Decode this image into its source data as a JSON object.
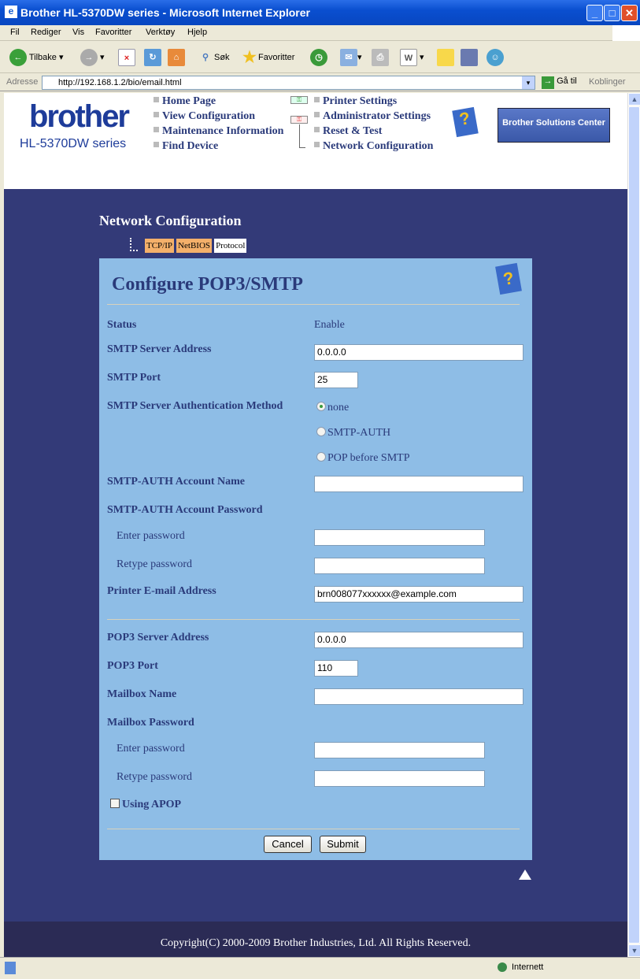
{
  "window": {
    "title": "Brother HL-5370DW series - Microsoft Internet Explorer"
  },
  "menu": [
    "Fil",
    "Rediger",
    "Vis",
    "Favoritter",
    "Verktøy",
    "Hjelp"
  ],
  "toolbar": {
    "back": "Tilbake",
    "search": "Søk",
    "favorites": "Favoritter"
  },
  "address": {
    "label": "Adresse",
    "url": "http://192.168.1.2/bio/email.html",
    "go": "Gå til",
    "links": "Koblinger"
  },
  "header": {
    "logo": "brother",
    "model": "HL-5370DW series",
    "solutions": "Brother Solutions Center",
    "nav_left": [
      "Home Page",
      "View Configuration",
      "Maintenance Information",
      "Find Device"
    ],
    "nav_right": [
      "Printer Settings",
      "Administrator Settings",
      "Reset & Test",
      "Network Configuration"
    ]
  },
  "section": {
    "title": "Network Configuration",
    "tabs": [
      "TCP/IP",
      "NetBIOS",
      "Protocol"
    ]
  },
  "form": {
    "title": "Configure POP3/SMTP",
    "status_label": "Status",
    "status_value": "Enable",
    "smtp_server_label": "SMTP Server Address",
    "smtp_server_value": "0.0.0.0",
    "smtp_port_label": "SMTP Port",
    "smtp_port_value": "25",
    "auth_label": "SMTP Server Authentication Method",
    "auth_options": [
      "none",
      "SMTP-AUTH",
      "POP before SMTP"
    ],
    "auth_selected": "none",
    "auth_account_label": "SMTP-AUTH Account Name",
    "auth_account_value": "",
    "auth_password_label": "SMTP-AUTH Account Password",
    "enter_password": "Enter password",
    "retype_password": "Retype password",
    "email_label": "Printer E-mail Address",
    "email_value": "brn008077xxxxxx@example.com",
    "pop3_server_label": "POP3 Server Address",
    "pop3_server_value": "0.0.0.0",
    "pop3_port_label": "POP3 Port",
    "pop3_port_value": "110",
    "mailbox_name_label": "Mailbox Name",
    "mailbox_name_value": "",
    "mailbox_password_label": "Mailbox Password",
    "apop_label": "Using APOP",
    "apop_checked": false,
    "cancel": "Cancel",
    "submit": "Submit"
  },
  "footer": {
    "copyright": "Copyright(C) 2000-2009 Brother Industries, Ltd. All Rights Reserved."
  },
  "status": {
    "zone": "Internett"
  },
  "colors": {
    "navy": "#333a78",
    "panel": "#8ebde6",
    "label": "#2a3a7a",
    "tab_active": "#f4b06a"
  }
}
